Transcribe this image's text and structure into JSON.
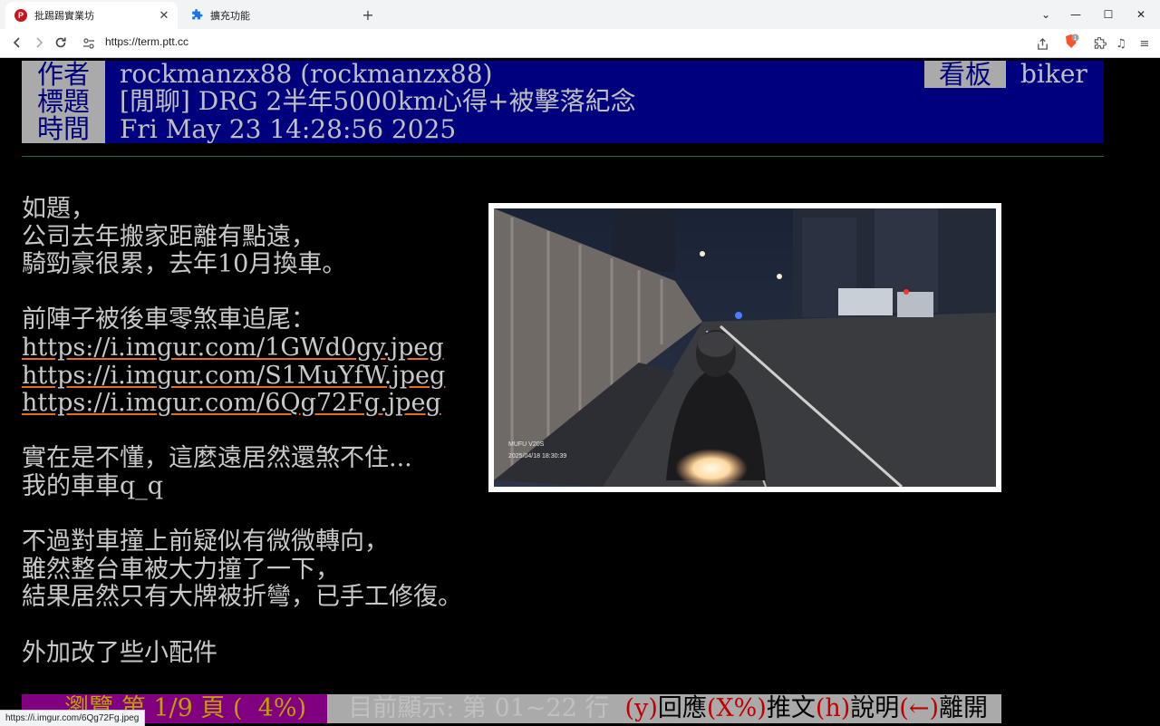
{
  "browser": {
    "tabs": [
      {
        "title": "批踢踢實業坊",
        "active": true
      },
      {
        "title": "擴充功能",
        "active": false
      }
    ],
    "url": "https://term.ptt.cc",
    "brave_badge": "1",
    "status_url": "https://i.imgur.com/6Qg72Fg.jpeg"
  },
  "header": {
    "author_label": "作者",
    "author": "rockmanzx88 (rockmanzx88)",
    "title_label": "標題",
    "title": "[閒聊] DRG 2半年5000km心得+被擊落紀念",
    "time_label": "時間",
    "time": "Fri May 23 14:28:56 2025",
    "board_label": "看板",
    "board": "biker"
  },
  "body": {
    "lines": [
      "如題，",
      "公司去年搬家距離有點遠，",
      "騎勁豪很累，去年10月換車。",
      "",
      "前陣子被後車零煞車追尾：",
      "https://i.imgur.com/1GWd0gy.jpeg",
      "https://i.imgur.com/S1MuYfW.jpeg",
      "https://i.imgur.com/6Qg72Fg.jpeg",
      "",
      "實在是不懂，這麼遠居然還煞不住...",
      "我的車車q_q",
      "",
      "不過對車撞上前疑似有微微轉向，",
      "雖然整台車被大力撞了一下，",
      "結果居然只有大牌被折彎，已手工修復。",
      "",
      "外加改了些小配件"
    ]
  },
  "photo": {
    "camera_label": "MUFU V20S",
    "camera_timestamp": "2025/04/18 18:30:39"
  },
  "statusbar": {
    "left": "  瀏覽 第 1/9 頁 (  4%) ",
    "middle": " 目前顯示: 第 01~22 行  ",
    "k1": "(y)",
    "v1": "回應",
    "k2": "(X%)",
    "v2": "推文",
    "k3": "(h)",
    "v3": "說明",
    "k4": "(←)",
    "v4": "離開"
  }
}
